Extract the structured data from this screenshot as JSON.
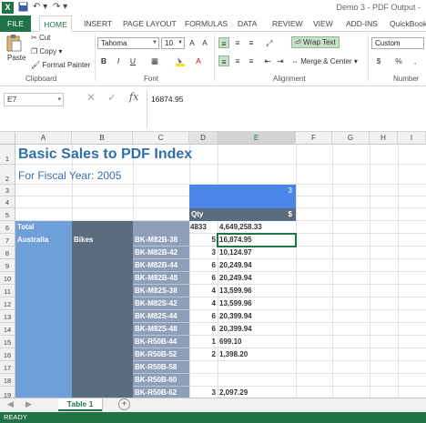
{
  "titlebar": {
    "title": "Demo 3 - PDF Output -",
    "logo": "X",
    "save_icon": "save-icon",
    "undo": "↶ ▾",
    "redo": "↷ ▾"
  },
  "tabs": [
    "FILE",
    "HOME",
    "INSERT",
    "PAGE LAYOUT",
    "FORMULAS",
    "DATA",
    "REVIEW",
    "VIEW",
    "ADD-INS",
    "QuickBooks"
  ],
  "ribbon": {
    "clipboard": {
      "paste": "Paste",
      "cut": "Cut",
      "copy": "Copy",
      "format_painter": "Format Painter",
      "label": "Clipboard"
    },
    "font": {
      "name": "Tahoma",
      "size": "10",
      "label": "Font",
      "bold": "B",
      "italic": "I",
      "underline": "U"
    },
    "alignment": {
      "wrap_text": "Wrap Text",
      "merge_center": "Merge & Center",
      "label": "Alignment"
    },
    "number": {
      "format": "Custom",
      "currency": "$",
      "percent": "%",
      "label": "Number"
    }
  },
  "formula_bar": {
    "name_box": "E7",
    "value": "16874.95",
    "cancel": "✕",
    "enter": "✓",
    "fx": "fx"
  },
  "columns": [
    "A",
    "B",
    "C",
    "D",
    "E",
    "F",
    "G",
    "H",
    "I"
  ],
  "rows": [
    "1",
    "2",
    "3",
    "4",
    "5",
    "6",
    "7",
    "8",
    "9",
    "10",
    "11",
    "12",
    "13",
    "14",
    "15",
    "16",
    "17",
    "18",
    "19"
  ],
  "sheet": {
    "title": "Basic Sales to PDF Index",
    "subtitle": "For Fiscal Year: 2005",
    "e3": "3",
    "qty_header": "Qty",
    "dollar_header": "$",
    "total_label": "Total",
    "total_qty": "4833",
    "total_amount": "4,649,258.33",
    "region": "Australia",
    "category": "Bikes",
    "items": [
      {
        "sku": "BK-M82B-38",
        "qty": "5",
        "amt": "16,874.95"
      },
      {
        "sku": "BK-M82B-42",
        "qty": "3",
        "amt": "10,124.97"
      },
      {
        "sku": "BK-M82B-44",
        "qty": "6",
        "amt": "20,249.94"
      },
      {
        "sku": "BK-M82B-48",
        "qty": "6",
        "amt": "20,249.94"
      },
      {
        "sku": "BK-M82S-38",
        "qty": "4",
        "amt": "13,599.96"
      },
      {
        "sku": "BK-M82S-42",
        "qty": "4",
        "amt": "13,599.96"
      },
      {
        "sku": "BK-M82S-44",
        "qty": "6",
        "amt": "20,399.94"
      },
      {
        "sku": "BK-M82S-48",
        "qty": "6",
        "amt": "20,399.94"
      },
      {
        "sku": "BK-R50B-44",
        "qty": "1",
        "amt": "699.10"
      },
      {
        "sku": "BK-R50B-52",
        "qty": "2",
        "amt": "1,398.20"
      },
      {
        "sku": "BK-R50B-58",
        "qty": "",
        "amt": ""
      },
      {
        "sku": "BK-R50B-60",
        "qty": "",
        "amt": ""
      },
      {
        "sku": "BK-R50B-62",
        "qty": "3",
        "amt": "2,097.29"
      }
    ]
  },
  "sheet_tabs": {
    "active": "Table 1",
    "add": "+"
  },
  "status": "READY",
  "colors": {
    "excel_green": "#217346",
    "title_blue": "#2f6fae",
    "header_blue": "#4a86e8",
    "slate": "#5b6c7f",
    "region_blue": "#6f9fd8"
  }
}
